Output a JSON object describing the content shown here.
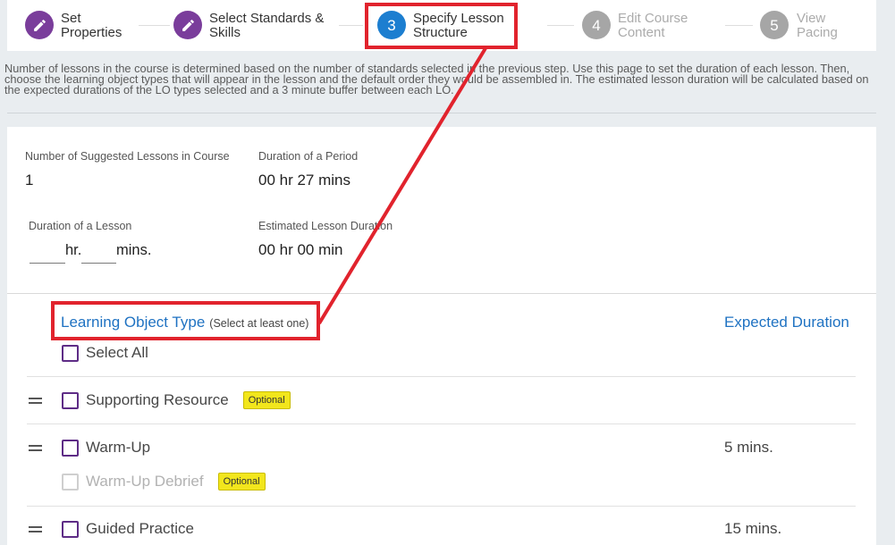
{
  "colors": {
    "page_background": "#e9edf0",
    "completed_step": "#7a3d9b",
    "active_step": "#1c7ed0",
    "upcoming_step": "#a6a6a6",
    "upcoming_step_text": "#ababab",
    "link_blue": "#1f72c2",
    "checkbox_border": "#5e2c86",
    "badge_background": "#f2e61c",
    "annotation": "#e1232d"
  },
  "stepper": {
    "steps": [
      {
        "icon": "pencil-icon",
        "label_lines": [
          "Set",
          "Properties"
        ]
      },
      {
        "icon": "pencil-icon",
        "label_lines": [
          "Select Standards &",
          "Skills"
        ]
      },
      {
        "number": "3",
        "label_lines": [
          "Specify Lesson",
          "Structure"
        ]
      },
      {
        "number": "4",
        "label_lines": [
          "Edit Course",
          "Content"
        ]
      },
      {
        "number": "5",
        "label_lines": [
          "View",
          "Pacing"
        ]
      }
    ]
  },
  "instructions": "Number of lessons in the course is determined based on the number of standards selected in the previous step. Use this page to set the duration of each lesson. Then, choose the learning object types that will appear in the lesson and the default order they would be assembled in. The estimated lesson duration will be calculated based on the expected durations of the LO types selected and a 3 minute buffer between each LO.",
  "summary": {
    "suggested_lessons": {
      "label": "Number of Suggested Lessons in Course",
      "value": "1"
    },
    "period_duration": {
      "label": "Duration of a Period",
      "value": "00 hr 27 mins"
    },
    "lesson_duration": {
      "label": "Duration of a Lesson",
      "hours_unit": "hr.",
      "minutes_unit": "mins."
    },
    "estimated_duration": {
      "label": "Estimated Lesson Duration",
      "value": "00 hr 00 min"
    }
  },
  "lo_types": {
    "heading": "Learning Object Type",
    "heading_hint": "(Select at least one)",
    "duration_heading": "Expected Duration",
    "select_all": {
      "label": "Select All",
      "checked": false
    },
    "rows": [
      {
        "label": "Supporting Resource",
        "badge": "Optional",
        "checked": false,
        "draggable": true
      },
      {
        "label": "Warm-Up",
        "duration": "5 mins.",
        "checked": false,
        "draggable": true,
        "children": [
          {
            "label": "Warm-Up Debrief",
            "badge": "Optional",
            "checked": false,
            "disabled": true
          }
        ]
      },
      {
        "label": "Guided Practice",
        "duration": "15 mins.",
        "checked": false,
        "draggable": true
      }
    ]
  }
}
